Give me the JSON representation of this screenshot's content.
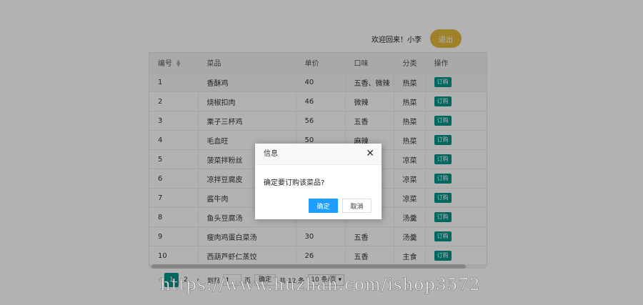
{
  "header": {
    "welcome": "欢迎回来！小李",
    "logout_label": "退出"
  },
  "table": {
    "columns": [
      "编号",
      "菜品",
      "单价",
      "口味",
      "分类",
      "操作"
    ],
    "rows": [
      {
        "id": "1",
        "name": "香酥鸡",
        "price": "40",
        "taste": "五香、微辣",
        "category": "热菜",
        "action": "订购"
      },
      {
        "id": "2",
        "name": "烧椒扣肉",
        "price": "46",
        "taste": "微辣",
        "category": "热菜",
        "action": "订购"
      },
      {
        "id": "3",
        "name": "栗子三杯鸡",
        "price": "56",
        "taste": "五香",
        "category": "热菜",
        "action": "订购"
      },
      {
        "id": "4",
        "name": "毛血旺",
        "price": "50",
        "taste": "麻辣",
        "category": "热菜",
        "action": "订购"
      },
      {
        "id": "5",
        "name": "菠菜拌粉丝",
        "price": "",
        "taste": "",
        "category": "凉菜",
        "action": "订购"
      },
      {
        "id": "6",
        "name": "凉拌豆腐皮",
        "price": "",
        "taste": "",
        "category": "凉菜",
        "action": "订购"
      },
      {
        "id": "7",
        "name": "酱牛肉",
        "price": "",
        "taste": "",
        "category": "凉菜",
        "action": "订购"
      },
      {
        "id": "8",
        "name": "鱼头豆腐汤",
        "price": "",
        "taste": "",
        "category": "汤羹",
        "action": "订购"
      },
      {
        "id": "9",
        "name": "瘦肉鸡蛋白菜汤",
        "price": "30",
        "taste": "五香",
        "category": "汤羹",
        "action": "订购"
      },
      {
        "id": "10",
        "name": "西葫芦虾仁蒸饺",
        "price": "26",
        "taste": "五香",
        "category": "主食",
        "action": "订购"
      }
    ]
  },
  "pager": {
    "prev_icon": "chevron-left-icon",
    "pages": [
      "1",
      "2"
    ],
    "next_icon": "chevron-right-icon",
    "goto_label": "到第",
    "goto_value": "1",
    "page_unit": "页",
    "confirm_label": "确定",
    "total_label": "共 12 条",
    "page_size": "10 条/页"
  },
  "dialog": {
    "title": "信息",
    "message": "确定要订购该菜品?",
    "ok_label": "确定",
    "cancel_label": "取消"
  },
  "watermark": "https://www.huzhan.com/ishop3572",
  "colors": {
    "accent": "#009688",
    "logout": "#e2b93b",
    "ok_button": "#1e9fff"
  }
}
